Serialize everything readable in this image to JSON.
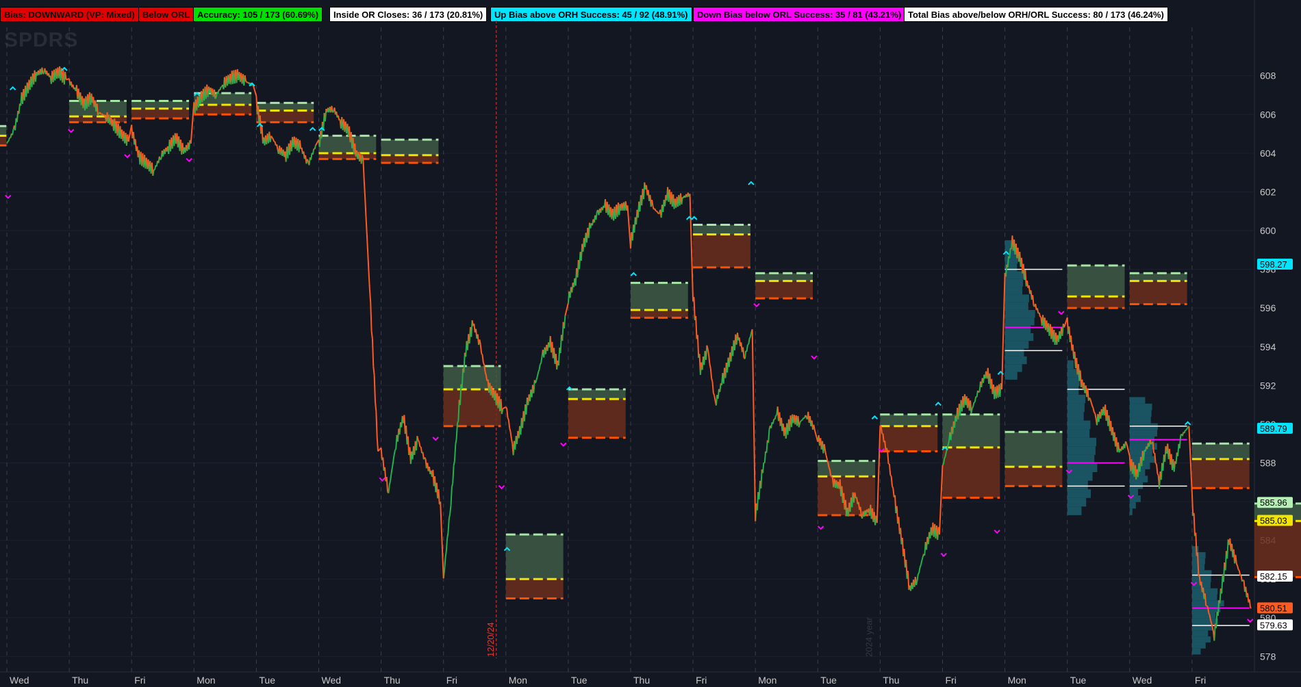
{
  "header": {
    "bias": "Bias: DOWNWARD (VP: Mixed)",
    "below_orl": "Below ORL",
    "accuracy": "Accuracy: 105 / 173  (60.69%)",
    "inside_or": "Inside OR Closes: 36 / 173  (20.81%)",
    "up_bias": "Up Bias above ORH Success: 45 / 92 (48.91%)",
    "down_bias": "Down Bias below ORL Success: 35 / 81 (43.21%)",
    "total_bias": "Total Bias above/below ORH/ORL Success: 80 / 173 (46.24%)"
  },
  "colors": {
    "background": "#131722",
    "up_candle": "#22b14c",
    "down_candle": "#ff5a1f",
    "or_box_upper": "#3e5a45",
    "or_box_lower": "#6b2e1c",
    "orh_line": "#a8e6a8",
    "mid_line": "#f2e600",
    "orl_line": "#ff5000",
    "up_marker": "#00e5ff",
    "down_marker": "#ff00ff",
    "volume_profile": "#1e6a78",
    "session_line": "#e53935"
  },
  "watermark": "SPDRS",
  "session_label": "12/20/24",
  "year_label": "2024 year",
  "chart_data": {
    "type": "line",
    "title": "",
    "ylim": [
      577.2,
      610.5
    ],
    "y_ticks": [
      578,
      580,
      582,
      584,
      586,
      588,
      590,
      592,
      594,
      596,
      598,
      600,
      602,
      604,
      606,
      608
    ],
    "x_day_labels": [
      "Wed",
      "Thu",
      "Fri",
      "Mon",
      "Tue",
      "Wed",
      "Thu",
      "Fri",
      "Mon",
      "Tue",
      "Thu",
      "Fri",
      "Mon",
      "Tue",
      "Thu",
      "Fri",
      "Mon",
      "Tue",
      "Wed",
      "Fri"
    ],
    "price_labels": [
      {
        "value": 598.27,
        "text": "598.27",
        "color": "#00e5ff"
      },
      {
        "value": 589.79,
        "text": "589.79",
        "color": "#00e5ff"
      },
      {
        "value": 585.96,
        "text": "585.96",
        "color": "#b4f0b4"
      },
      {
        "value": 585.03,
        "text": "585.03",
        "color": "#f2e600"
      },
      {
        "value": 582.15,
        "text": "582.15",
        "color": "#ffffff"
      },
      {
        "value": 580.51,
        "text": "580.51",
        "color": "#ff5a1f"
      },
      {
        "value": 579.63,
        "text": "579.63",
        "color": "#ffffff"
      }
    ],
    "opening_ranges": [
      {
        "day": "Tue",
        "orh": 605.4,
        "mid": 604.9,
        "orl": 604.4,
        "open_hi": 605.4
      },
      {
        "day": "Wed",
        "orh": 606.7,
        "mid": 605.9,
        "orl": 605.6
      },
      {
        "day": "Thu",
        "orh": 606.7,
        "mid": 606.3,
        "orl": 605.8
      },
      {
        "day": "Fri",
        "orh": 607.1,
        "mid": 606.5,
        "orl": 606.0
      },
      {
        "day": "Mon",
        "orh": 606.6,
        "mid": 606.2,
        "orl": 605.6
      },
      {
        "day": "Tue",
        "orh": 604.9,
        "mid": 604.0,
        "orl": 603.7
      },
      {
        "day": "Wed",
        "orh": 604.7,
        "mid": 603.9,
        "orl": 603.5
      },
      {
        "day": "Thu",
        "orh": 593.0,
        "mid": 591.8,
        "orl": 589.9
      },
      {
        "day": "Fri",
        "orh": 584.3,
        "mid": 582.0,
        "orl": 581.0
      },
      {
        "day": "Mon",
        "orh": 591.8,
        "mid": 591.3,
        "orl": 589.3
      },
      {
        "day": "Tue",
        "orh": 597.3,
        "mid": 595.9,
        "orl": 595.5
      },
      {
        "day": "Thu",
        "orh": 600.3,
        "mid": 599.8,
        "orl": 598.1
      },
      {
        "day": "Fri",
        "orh": 597.8,
        "mid": 597.4,
        "orl": 596.5
      },
      {
        "day": "Mon",
        "orh": 588.1,
        "mid": 587.3,
        "orl": 585.3
      },
      {
        "day": "Tue",
        "orh": 590.5,
        "mid": 589.9,
        "orl": 588.6
      },
      {
        "day": "Thu",
        "orh": 590.5,
        "mid": 588.8,
        "orl": 586.2
      },
      {
        "day": "Fri",
        "orh": 589.6,
        "mid": 587.8,
        "orl": 586.8
      },
      {
        "day": "Mon",
        "orh": 598.2,
        "mid": 596.6,
        "orl": 596.0
      },
      {
        "day": "Tue",
        "orh": 597.8,
        "mid": 597.4,
        "orl": 596.2
      },
      {
        "day": "Wed",
        "orh": 589.0,
        "mid": 588.2,
        "orl": 586.7
      },
      {
        "day": "Fri",
        "orh": 585.9,
        "mid": 585.0,
        "orl": 582.1
      }
    ],
    "price_series": [
      {
        "day": "Wed",
        "values": [
          604.5,
          605.2,
          606.8,
          607.5,
          608.1,
          608.3,
          607.9,
          608.2,
          607.8
        ]
      },
      {
        "day": "Thu",
        "values": [
          607.7,
          607.2,
          606.5,
          606.9,
          606.1,
          605.9,
          605.5,
          605.0,
          604.6
        ]
      },
      {
        "day": "Fri",
        "values": [
          605.2,
          603.8,
          603.5,
          603.1,
          603.9,
          604.3,
          604.8,
          604.1,
          604.5
        ]
      },
      {
        "day": "Mon",
        "values": [
          606.3,
          606.9,
          607.3,
          607.0,
          607.6,
          607.9,
          608.0,
          607.7,
          607.5
        ]
      },
      {
        "day": "Tue",
        "values": [
          606.6,
          604.6,
          604.9,
          604.2,
          603.9,
          604.6,
          604.3,
          603.4,
          604.4
        ]
      },
      {
        "day": "Wed",
        "values": [
          604.4,
          606.2,
          606.3,
          605.6,
          605.2,
          604.0,
          603.6,
          596.0,
          588.6
        ]
      },
      {
        "day": "Thu",
        "values": [
          588.6,
          586.5,
          589.0,
          590.4,
          588.2,
          589.2,
          588.0,
          587.3,
          586.0
        ]
      },
      {
        "day": "Fri",
        "values": [
          582.0,
          586.0,
          590.5,
          593.8,
          595.2,
          594.0,
          592.0,
          591.4,
          590.8
        ]
      },
      {
        "day": "Mon",
        "values": [
          591.0,
          588.7,
          589.8,
          591.2,
          592.1,
          593.6,
          594.2,
          593.0,
          595.6
        ]
      },
      {
        "day": "Tue",
        "values": [
          596.5,
          597.5,
          599.2,
          600.2,
          600.9,
          601.3,
          600.8,
          601.2,
          601.3
        ]
      },
      {
        "day": "Thu",
        "values": [
          599.4,
          601.0,
          602.3,
          601.2,
          600.8,
          601.9,
          601.4,
          601.7,
          601.9
        ]
      },
      {
        "day": "Fri",
        "values": [
          596.7,
          592.8,
          593.9,
          591.0,
          592.3,
          593.4,
          594.6,
          593.5,
          594.9
        ]
      },
      {
        "day": "Mon",
        "values": [
          585.3,
          587.6,
          589.8,
          590.6,
          589.5,
          590.3,
          590.1,
          590.5,
          589.7
        ]
      },
      {
        "day": "Tue",
        "values": [
          589.3,
          588.6,
          587.0,
          586.8,
          585.4,
          586.4,
          585.3,
          585.6,
          584.9
        ]
      },
      {
        "day": "Thu",
        "values": [
          590.0,
          588.4,
          586.0,
          583.8,
          581.5,
          582.0,
          583.5,
          584.6,
          584.3
        ]
      },
      {
        "day": "Fri",
        "values": [
          587.8,
          589.3,
          590.5,
          591.3,
          590.8,
          591.9,
          592.7,
          591.6,
          591.8
        ]
      },
      {
        "day": "Mon",
        "values": [
          597.6,
          599.4,
          598.6,
          597.3,
          596.2,
          595.4,
          594.9,
          594.3,
          595.0
        ]
      },
      {
        "day": "Tue",
        "values": [
          595.2,
          593.4,
          592.1,
          591.4,
          590.2,
          590.8,
          589.7,
          588.6,
          589.0
        ]
      },
      {
        "day": "Wed",
        "values": [
          588.0,
          587.4,
          588.6,
          589.2,
          587.0,
          588.8,
          587.7,
          589.4,
          589.9
        ]
      },
      {
        "day": "Fri",
        "values": [
          586.1,
          582.0,
          580.7,
          579.1,
          581.6,
          584.0,
          582.8,
          581.7,
          580.5
        ]
      }
    ],
    "up_markers": [
      {
        "day_index": 0,
        "pos": 0.1,
        "price": 607.2
      },
      {
        "day_index": 0,
        "pos": 0.97,
        "price": 608.2
      },
      {
        "day_index": 3,
        "pos": 0.05,
        "price": 606.9
      },
      {
        "day_index": 3,
        "pos": 0.98,
        "price": 607.4
      },
      {
        "day_index": 4,
        "pos": 0.06,
        "price": 605.3
      },
      {
        "day_index": 4,
        "pos": 0.95,
        "price": 605.1
      },
      {
        "day_index": 5,
        "pos": 0.05,
        "price": 605.1
      },
      {
        "day_index": 8,
        "pos": 0.02,
        "price": 583.4
      },
      {
        "day_index": 9,
        "pos": 0.02,
        "price": 591.7
      },
      {
        "day_index": 10,
        "pos": 0.05,
        "price": 597.6
      },
      {
        "day_index": 10,
        "pos": 0.99,
        "price": 600.5
      },
      {
        "day_index": 11,
        "pos": 0.02,
        "price": 600.5
      },
      {
        "day_index": 11,
        "pos": 0.98,
        "price": 602.3
      },
      {
        "day_index": 13,
        "pos": 0.96,
        "price": 590.2
      },
      {
        "day_index": 14,
        "pos": 0.98,
        "price": 590.9
      },
      {
        "day_index": 15,
        "pos": 0.04,
        "price": 588.6
      },
      {
        "day_index": 15,
        "pos": 0.98,
        "price": 592.5
      },
      {
        "day_index": 16,
        "pos": 0.02,
        "price": 598.7
      },
      {
        "day_index": 18,
        "pos": 0.98,
        "price": 589.9
      }
    ],
    "down_markers": [
      {
        "day_index": 0,
        "pos": 0.02,
        "price": 601.9
      },
      {
        "day_index": 1,
        "pos": 0.03,
        "price": 605.3
      },
      {
        "day_index": 1,
        "pos": 0.98,
        "price": 604.0
      },
      {
        "day_index": 2,
        "pos": 0.97,
        "price": 603.8
      },
      {
        "day_index": 6,
        "pos": 0.02,
        "price": 587.3
      },
      {
        "day_index": 6,
        "pos": 0.92,
        "price": 589.4
      },
      {
        "day_index": 7,
        "pos": 0.98,
        "price": 586.9
      },
      {
        "day_index": 8,
        "pos": 0.97,
        "price": 589.1
      },
      {
        "day_index": 12,
        "pos": 0.02,
        "price": 596.3
      },
      {
        "day_index": 12,
        "pos": 0.99,
        "price": 593.6
      },
      {
        "day_index": 13,
        "pos": 0.05,
        "price": 584.8
      },
      {
        "day_index": 14,
        "pos": 0.02,
        "price": 588.8
      },
      {
        "day_index": 15,
        "pos": 0.92,
        "price": 584.6
      },
      {
        "day_index": 15,
        "pos": 0.02,
        "price": 583.4
      },
      {
        "day_index": 16,
        "pos": 0.95,
        "price": 595.9
      },
      {
        "day_index": 17,
        "pos": 0.03,
        "price": 587.7
      },
      {
        "day_index": 18,
        "pos": 0.02,
        "price": 586.4
      },
      {
        "day_index": 19,
        "pos": 0.03,
        "price": 581.9
      },
      {
        "day_index": 19,
        "pos": 0.98,
        "price": 580.0
      }
    ],
    "volume_profiles": [
      {
        "day_index": 16,
        "vah": 598.0,
        "poc": 595.0,
        "val": 593.8
      },
      {
        "day_index": 17,
        "vah": 591.8,
        "poc": 588.0,
        "val": 586.8
      },
      {
        "day_index": 18,
        "vah": 589.9,
        "poc": 589.2,
        "val": 586.8
      },
      {
        "day_index": 19,
        "vah": 582.2,
        "poc": 580.5,
        "val": 579.6
      }
    ]
  }
}
